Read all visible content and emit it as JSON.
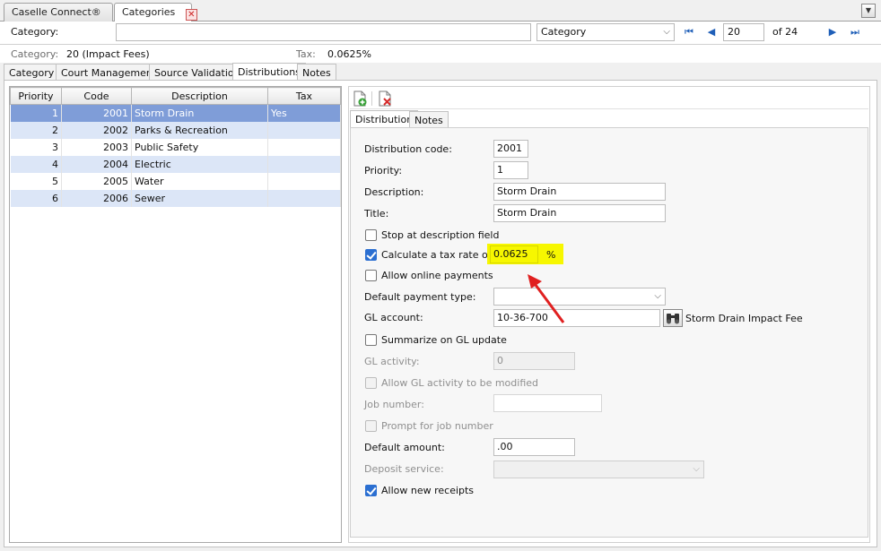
{
  "doc_tabs": [
    {
      "label": "Caselle Connect®"
    },
    {
      "label": "Categories"
    }
  ],
  "category_bar": {
    "label": "Category:",
    "value": "",
    "selector": "Category",
    "record_number": "20",
    "record_total": "of 24"
  },
  "info": {
    "category_label": "Category:",
    "category_value": "20 (Impact Fees)",
    "tax_label": "Tax:",
    "tax_value": "0.0625%"
  },
  "sub_tabs": [
    "Category",
    "Court Management",
    "Source Validation",
    "Distributions",
    "Notes"
  ],
  "grid": {
    "columns": [
      "Priority",
      "Code",
      "Description",
      "Tax"
    ],
    "rows": [
      {
        "priority": "1",
        "code": "2001",
        "description": "Storm Drain",
        "tax": "Yes"
      },
      {
        "priority": "2",
        "code": "2002",
        "description": "Parks & Recreation",
        "tax": ""
      },
      {
        "priority": "3",
        "code": "2003",
        "description": "Public Safety",
        "tax": ""
      },
      {
        "priority": "4",
        "code": "2004",
        "description": "Electric",
        "tax": ""
      },
      {
        "priority": "5",
        "code": "2005",
        "description": "Water",
        "tax": ""
      },
      {
        "priority": "6",
        "code": "2006",
        "description": "Sewer",
        "tax": ""
      }
    ]
  },
  "inner_tabs": [
    "Distribution",
    "Notes"
  ],
  "form": {
    "distribution_code_label": "Distribution code:",
    "distribution_code": "2001",
    "priority_label": "Priority:",
    "priority": "1",
    "description_label": "Description:",
    "description": "Storm Drain",
    "title_label": "Title:",
    "title": "Storm Drain",
    "stop_at_description_label": "Stop at description field",
    "calc_tax_label": "Calculate a tax rate of:",
    "tax_rate": "0.0625",
    "tax_unit": "%",
    "allow_online_label": "Allow online payments",
    "default_payment_type_label": "Default payment type:",
    "default_payment_type": "",
    "gl_account_label": "GL account:",
    "gl_account": "10-36-700",
    "gl_account_desc": "Storm Drain Impact Fee",
    "summarize_label": "Summarize on GL update",
    "gl_activity_label": "GL activity:",
    "gl_activity": "0",
    "allow_gl_mod_label": "Allow GL activity to be modified",
    "job_number_label": "Job number:",
    "job_number": "",
    "prompt_job_label": "Prompt for job number",
    "default_amount_label": "Default amount:",
    "default_amount": ".00",
    "deposit_service_label": "Deposit service:",
    "deposit_service": "",
    "allow_receipts_label": "Allow new receipts"
  },
  "colors": {
    "highlight": "#f7f700",
    "selection": "#7f9dd8",
    "alt_row": "#dce6f7",
    "annotation_arrow": "#e02020"
  }
}
